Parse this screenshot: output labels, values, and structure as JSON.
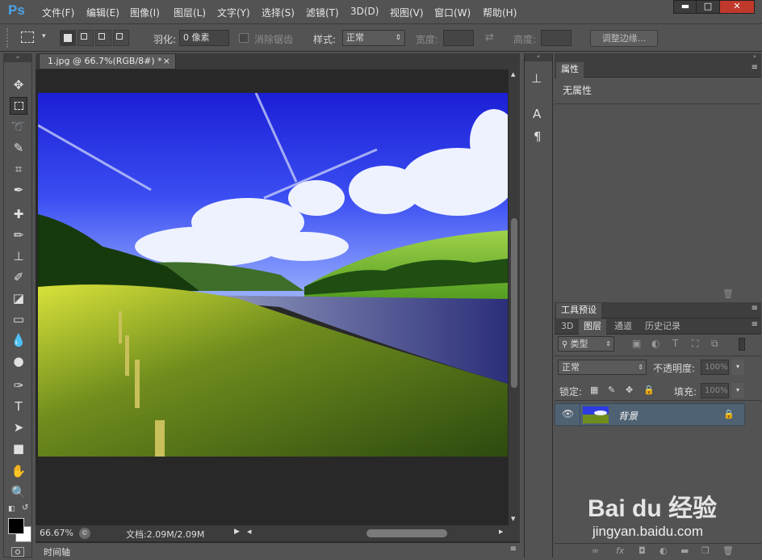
{
  "app": {
    "logo": "Ps"
  },
  "menu": [
    "文件(F)",
    "编辑(E)",
    "图像(I)",
    "图层(L)",
    "文字(Y)",
    "选择(S)",
    "滤镜(T)",
    "3D(D)",
    "视图(V)",
    "窗口(W)",
    "帮助(H)"
  ],
  "window_controls": {
    "minimize": "▬",
    "maximize": "□",
    "close": "✕"
  },
  "options": {
    "feather_label": "羽化:",
    "feather_value": "0 像素",
    "antialias_label": "消除锯齿",
    "style_label": "样式:",
    "style_value": "正常",
    "width_label": "宽度:",
    "height_label": "高度:",
    "refine_edge_button": "调整边缘..."
  },
  "document": {
    "tab_title": "1.jpg @ 66.7%(RGB/8#) *",
    "tab_close": "×",
    "zoom": "66.67%",
    "doc_size": "文档:2.09M/2.09M"
  },
  "timeline_label": "时间轴",
  "panels": {
    "properties": {
      "title": "属性",
      "body": "无属性"
    },
    "tool_presets_tab": "工具预设",
    "history_tab": "历史记录",
    "layers_tabs": [
      "3D",
      "图层",
      "通道",
      "历史记录"
    ],
    "filter_kind": "类型",
    "blend_mode": "正常",
    "opacity_label": "不透明度:",
    "opacity_value": "100%",
    "lock_label": "锁定:",
    "fill_label": "填充:",
    "fill_value": "100%",
    "layer_name": "背景"
  },
  "watermark": {
    "brand": "Bai du 经验",
    "url": "jingyan.baidu.com"
  },
  "colors": {
    "accent": "#4aa3e8",
    "selected_layer": "#4f6273"
  }
}
